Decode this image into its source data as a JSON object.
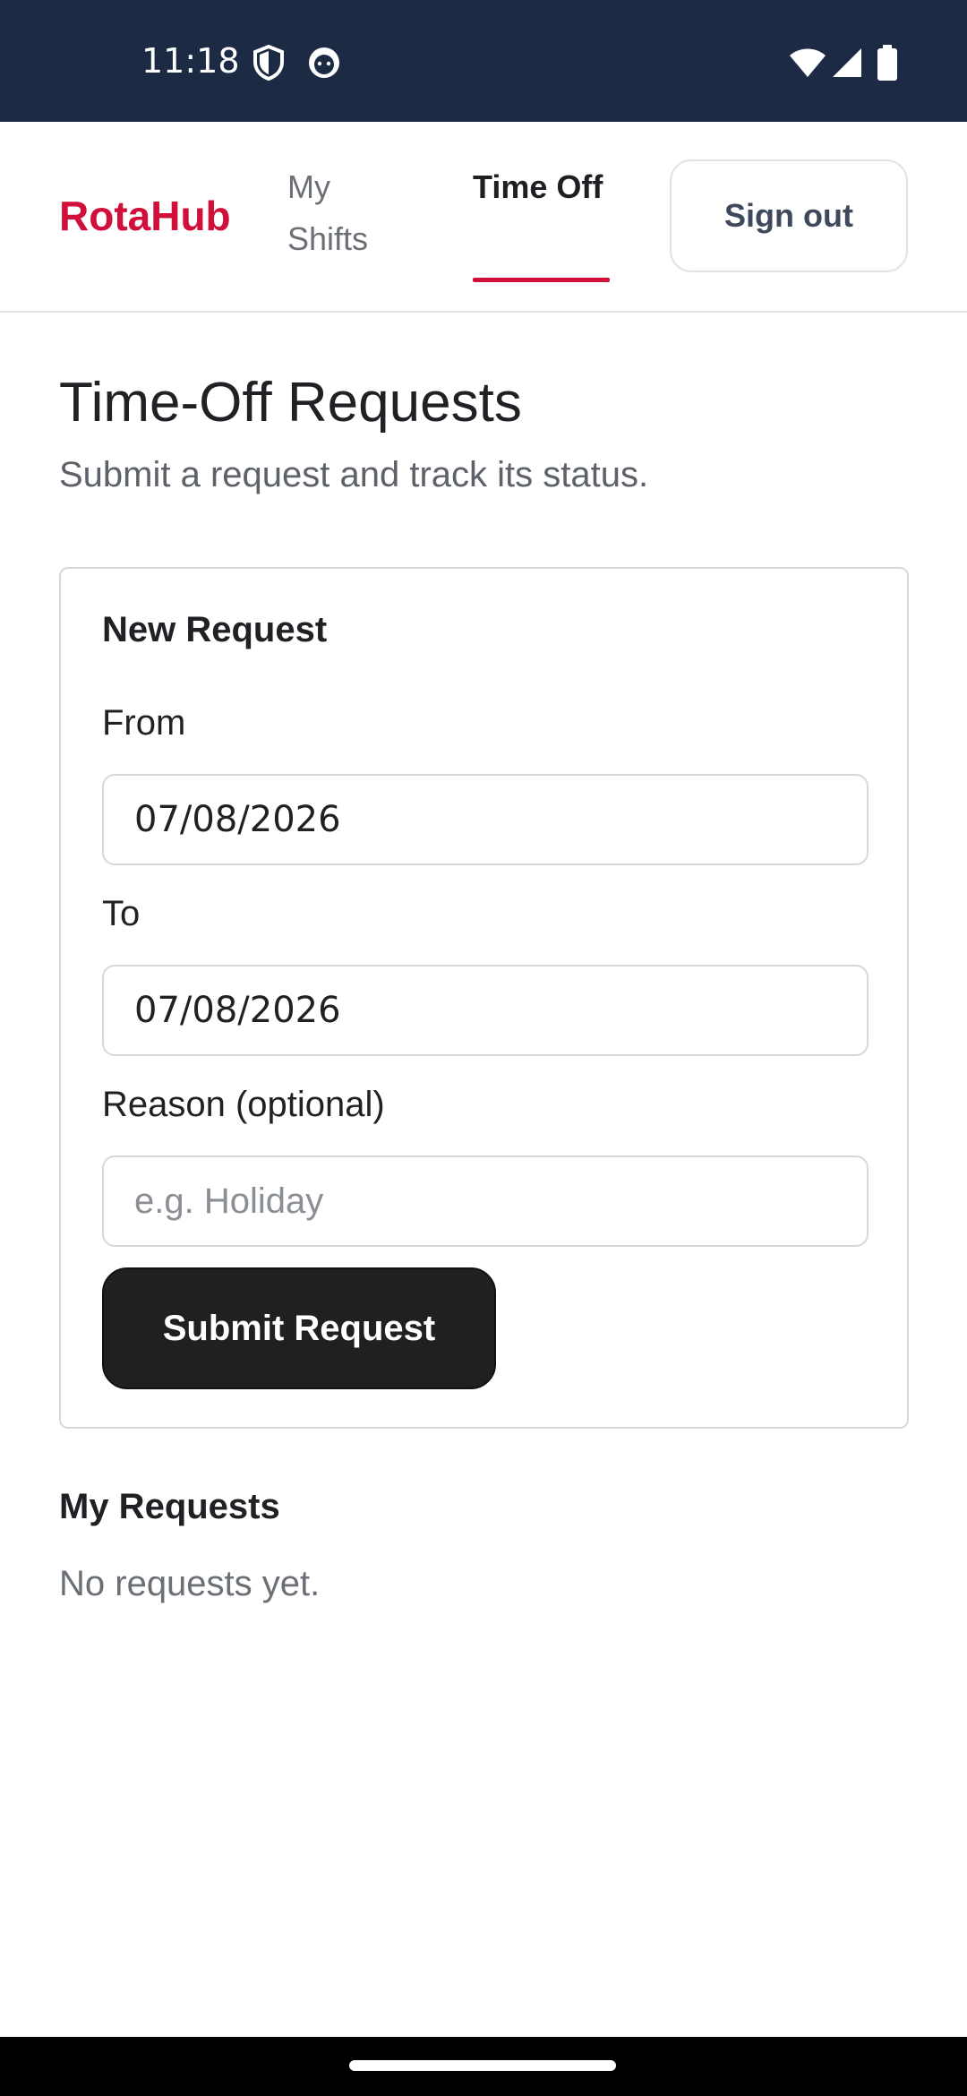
{
  "status_bar": {
    "time": "11:18",
    "icons": [
      "shield-icon",
      "face-icon",
      "wifi-icon",
      "signal-icon",
      "battery-icon"
    ]
  },
  "header": {
    "brand": "RotaHub",
    "nav": [
      {
        "label": "My Shifts",
        "active": false
      },
      {
        "label": "Time Off",
        "active": true
      }
    ],
    "signout_label": "Sign out",
    "brand_color": "#d0103a"
  },
  "page": {
    "title": "Time-Off Requests",
    "subtitle": "Submit a request and track its status."
  },
  "form": {
    "title": "New Request",
    "from_label": "From",
    "from_value": "07/08/2026",
    "to_label": "To",
    "to_value": "07/08/2026",
    "reason_label": "Reason (optional)",
    "reason_placeholder": "e.g. Holiday",
    "submit_label": "Submit Request"
  },
  "requests": {
    "title": "My Requests",
    "empty_text": "No requests yet."
  }
}
